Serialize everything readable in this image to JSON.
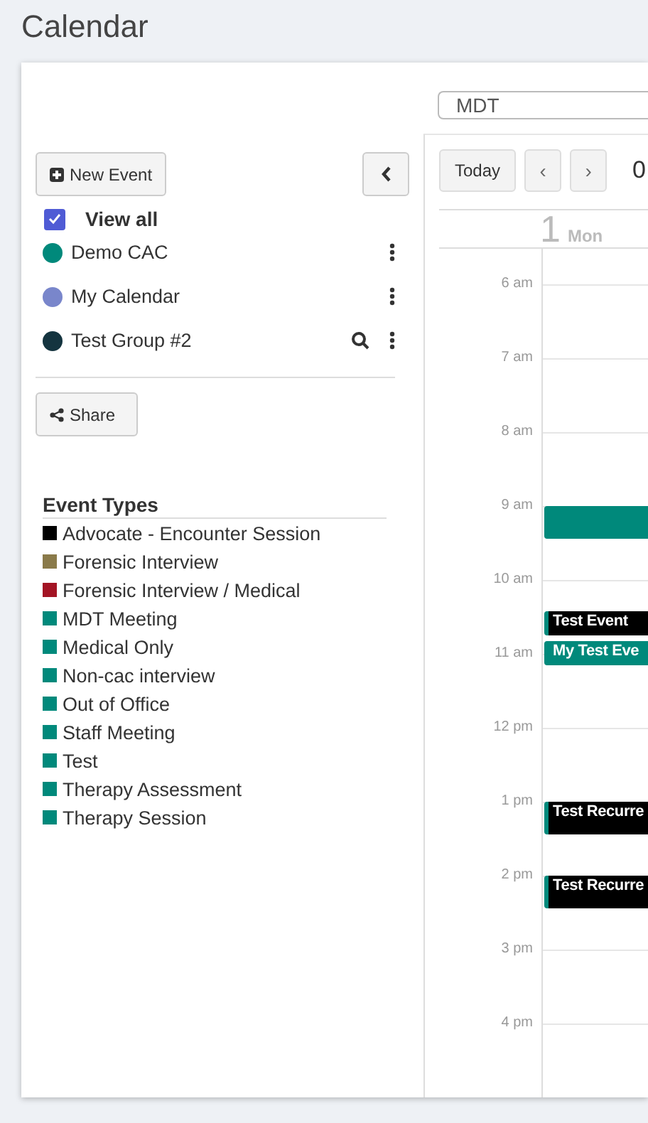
{
  "page_title": "Calendar",
  "sidebar": {
    "new_event_button": "New Event",
    "view_all": {
      "label": "View all",
      "checked": true
    },
    "calendars": [
      {
        "name": "Demo CAC",
        "color": "#00897b",
        "search": false
      },
      {
        "name": "My Calendar",
        "color": "#7986cb",
        "search": false
      },
      {
        "name": "Test Group #2",
        "color": "#14343f",
        "search": true
      }
    ],
    "share_button": "Share",
    "event_types_heading": "Event Types",
    "event_types": [
      {
        "name": "Advocate - Encounter Session",
        "color": "#000000"
      },
      {
        "name": "Forensic Interview",
        "color": "#8a7a4a"
      },
      {
        "name": "Forensic Interview / Medical",
        "color": "#a31424"
      },
      {
        "name": "MDT Meeting",
        "color": "#00897b"
      },
      {
        "name": "Medical Only",
        "color": "#00897b"
      },
      {
        "name": "Non-cac interview",
        "color": "#00897b"
      },
      {
        "name": "Out of Office",
        "color": "#00897b"
      },
      {
        "name": "Staff Meeting",
        "color": "#00897b"
      },
      {
        "name": "Test",
        "color": "#00897b"
      },
      {
        "name": "Therapy Assessment",
        "color": "#00897b"
      },
      {
        "name": "Therapy Session",
        "color": "#00897b"
      }
    ]
  },
  "calendar": {
    "timezone": "MDT",
    "today_button": "Today",
    "prev_button": "‹",
    "next_button": "›",
    "range_title": "0",
    "day_number": "1",
    "day_name": "Mon",
    "hours": [
      "6 am",
      "7 am",
      "8 am",
      "9 am",
      "10 am",
      "11 am",
      "12 pm",
      "1 pm",
      "2 pm",
      "3 pm",
      "4 pm"
    ],
    "events": [
      {
        "color": "#00897b"
      },
      {
        "title": "Test Event",
        "color": "#000000"
      },
      {
        "title": "My Test Eve",
        "color": "#00897b"
      },
      {
        "title": "Test Recurre",
        "color": "#000000"
      },
      {
        "title": "Test Recurre",
        "color": "#000000"
      }
    ]
  }
}
